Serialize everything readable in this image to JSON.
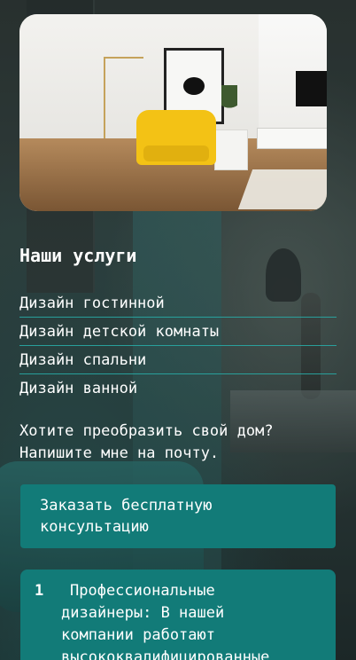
{
  "hero": {
    "image_alt": "Интерьер гостиной с желтым креслом"
  },
  "services": {
    "title": "Наши услуги",
    "items": [
      "Дизайн гостинной",
      "Дизайн детской комнаты",
      "Дизайн спальни",
      "Дизайн ванной"
    ]
  },
  "cta": {
    "line1": "Хотите преобразить свой дом?",
    "line2": "Напишите мне на почту.",
    "button_line1": "Заказать бесплатную",
    "button_line2": "консультацию"
  },
  "features": [
    {
      "number": "1",
      "text_lines": [
        "Профессиональные",
        "дизайнеры: В нашей",
        "компании работают",
        "высококвалифицированные"
      ]
    }
  ],
  "colors": {
    "accent": "#127b78",
    "divider": "#28aaa5",
    "text": "#ffffff"
  }
}
